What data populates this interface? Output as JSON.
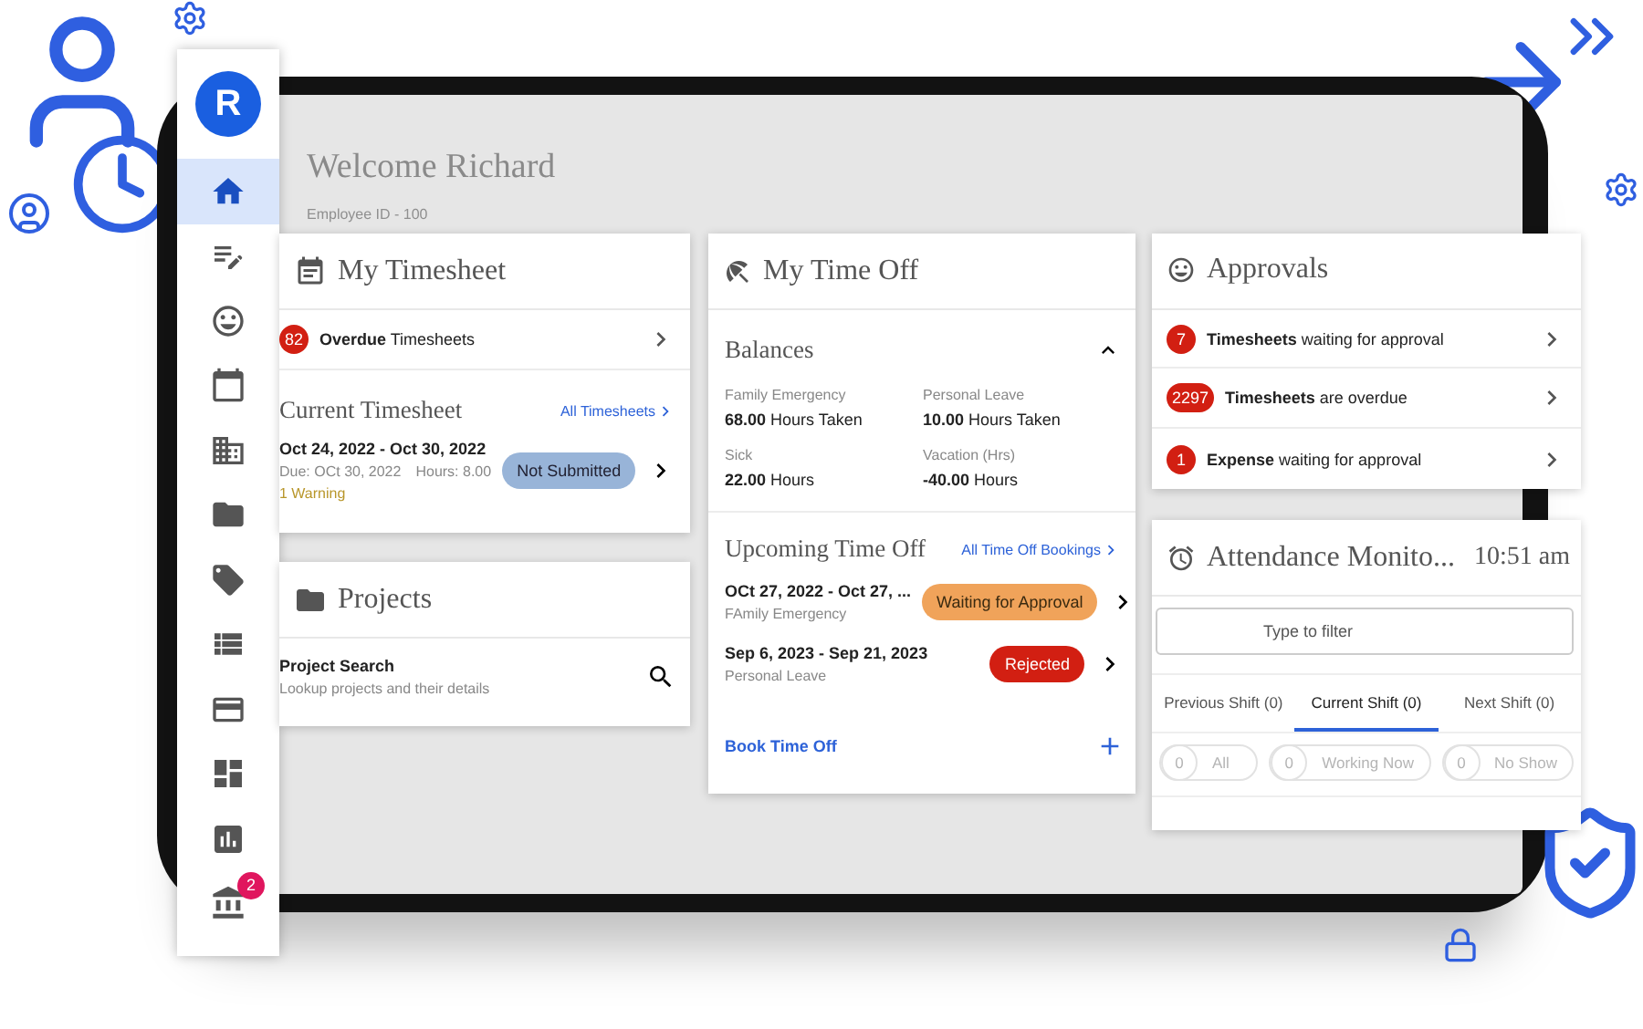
{
  "sidebar": {
    "logo": "R",
    "items": [
      {
        "selected": true
      },
      {
        "selected": false
      },
      {
        "selected": false
      },
      {
        "selected": false
      },
      {
        "selected": false
      },
      {
        "selected": false
      },
      {
        "selected": false
      },
      {
        "selected": false
      },
      {
        "selected": false
      },
      {
        "selected": false
      },
      {
        "selected": false
      },
      {
        "selected": false,
        "badge": "2"
      }
    ]
  },
  "welcome": {
    "title": "Welcome Richard",
    "subtitle": "Employee ID - 100"
  },
  "timesheet": {
    "title": "My Timesheet",
    "overdue": {
      "count": "82",
      "text": "**Overdue** Timesheets"
    },
    "current": {
      "title": "Current Timesheet",
      "link": "All Timesheets",
      "period": "Oct 24, 2022 - Oct 30, 2022",
      "due": "Due: OCt 30, 2022",
      "hours": "Hours: 8.00",
      "warning": "1 Warning",
      "status": "Not Submitted"
    }
  },
  "projects": {
    "title": "Projects",
    "item": {
      "title": "Project Search",
      "subtitle": "Lookup projects and their details"
    }
  },
  "time_off": {
    "title": "My Time Off",
    "balances": {
      "title": "Balances",
      "expanded": true,
      "items": [
        {
          "label": "Family Emergency",
          "value": "**68.00** Hours Taken"
        },
        {
          "label": "Personal Leave",
          "value": "**10.00** Hours Taken"
        },
        {
          "label": "Sick",
          "value": "**22.00** Hours"
        },
        {
          "label": "Vacation (Hrs)",
          "value": "**-40.00** Hours"
        }
      ]
    },
    "upcoming": {
      "title": "Upcoming Time Off",
      "link": "All Time Off Bookings",
      "items": [
        {
          "period": "OCt 27, 2022 - Oct 27, ...",
          "type": "FAmily Emergency",
          "status": "Waiting for Approval",
          "kind": "pending"
        },
        {
          "period": "Sep 6, 2023 - Sep 21, 2023",
          "type": "Personal Leave",
          "status": "Rejected",
          "kind": "rejected"
        }
      ]
    },
    "action": "Book Time Off"
  },
  "approvals": {
    "title": "Approvals",
    "items": [
      {
        "count": "7",
        "text": "**Timesheets** waiting for approval"
      },
      {
        "count": "2297",
        "text": "**Timesheets** are overdue"
      },
      {
        "count": "1",
        "text": "**Expense** waiting for approval"
      }
    ]
  },
  "attendance": {
    "title": "Attendance Monito...",
    "time": "10:51 am",
    "filter": {
      "placeholder": "Type to filter"
    },
    "tabs": [
      {
        "label": "Previous Shift (0)",
        "selected": false
      },
      {
        "label": "Current Shift (0)",
        "selected": true
      },
      {
        "label": "Next Shift (0)",
        "selected": false
      }
    ],
    "chips": [
      {
        "count": "0",
        "label": "All",
        "disabled": true
      },
      {
        "count": "0",
        "label": "Working Now",
        "disabled": true
      },
      {
        "count": "0",
        "label": "No Show",
        "disabled": true
      }
    ]
  }
}
